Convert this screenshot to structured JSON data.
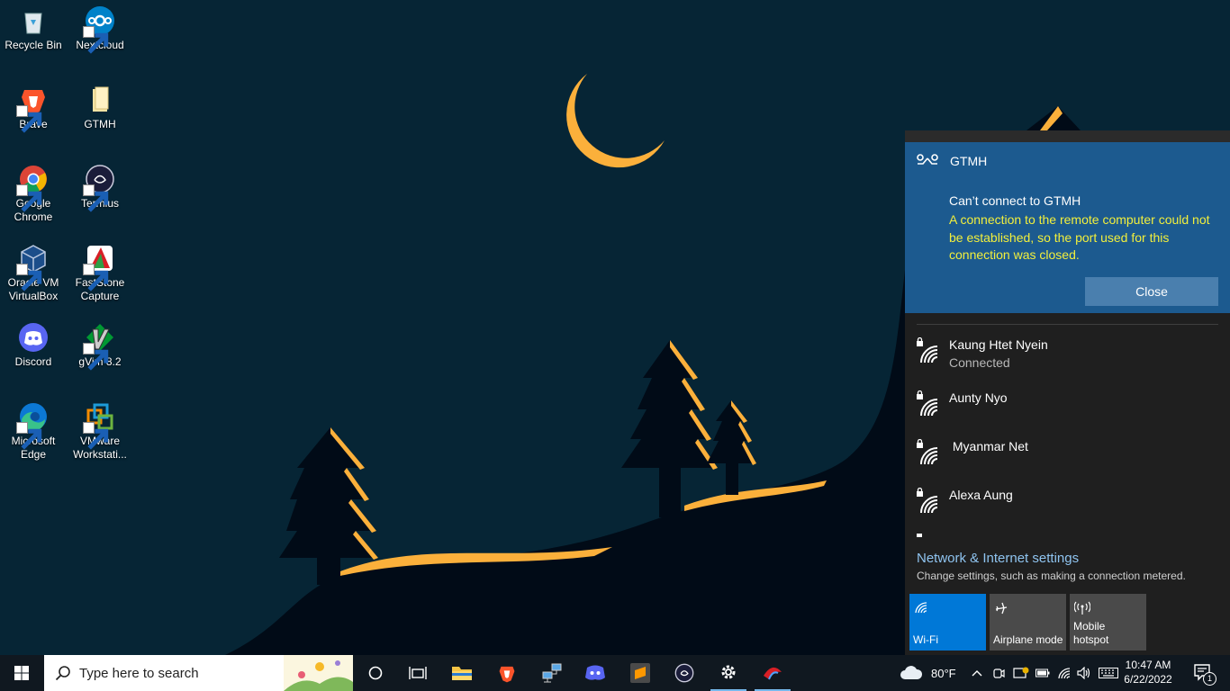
{
  "desktop": {
    "icons": [
      {
        "label": "Recycle Bin"
      },
      {
        "label": "Nextcloud"
      },
      {
        "label": "Brave"
      },
      {
        "label": "GTMH"
      },
      {
        "label": "Google Chrome"
      },
      {
        "label": "Termius"
      },
      {
        "label": "Oracle VM VirtualBox"
      },
      {
        "label": "FastStone Capture"
      },
      {
        "label": "Discord"
      },
      {
        "label": "gVim 8.2"
      },
      {
        "label": "Microsoft Edge"
      },
      {
        "label": "VMware Workstati..."
      }
    ]
  },
  "notification": {
    "app_name": "GTMH",
    "title": "Can’t connect to GTMH",
    "body": "A connection to the remote computer could not be established, so the port used for this connection was closed.",
    "close_label": "Close",
    "accent": "#1c5a8f",
    "body_color": "#f2ef3c"
  },
  "networks": [
    {
      "name": "Kaung Htet Nyein",
      "status": "Connected"
    },
    {
      "name": "Aunty Nyo",
      "status": ""
    },
    {
      "name": " Myanmar Net",
      "status": ""
    },
    {
      "name": "Alexa Aung",
      "status": ""
    }
  ],
  "network_settings": {
    "link": "Network & Internet settings",
    "description": "Change settings, such as making a connection metered."
  },
  "quick_actions": [
    {
      "label": "Wi-Fi",
      "active": true,
      "icon": "wifi-icon"
    },
    {
      "label": "Airplane mode",
      "active": false,
      "icon": "airplane-icon"
    },
    {
      "label": "Mobile hotspot",
      "active": false,
      "icon": "hotspot-icon"
    }
  ],
  "taskbar": {
    "search_placeholder": "Type here to search",
    "weather": "80°F",
    "time": "10:47 AM",
    "date": "6/22/2022",
    "notification_count": "1"
  }
}
